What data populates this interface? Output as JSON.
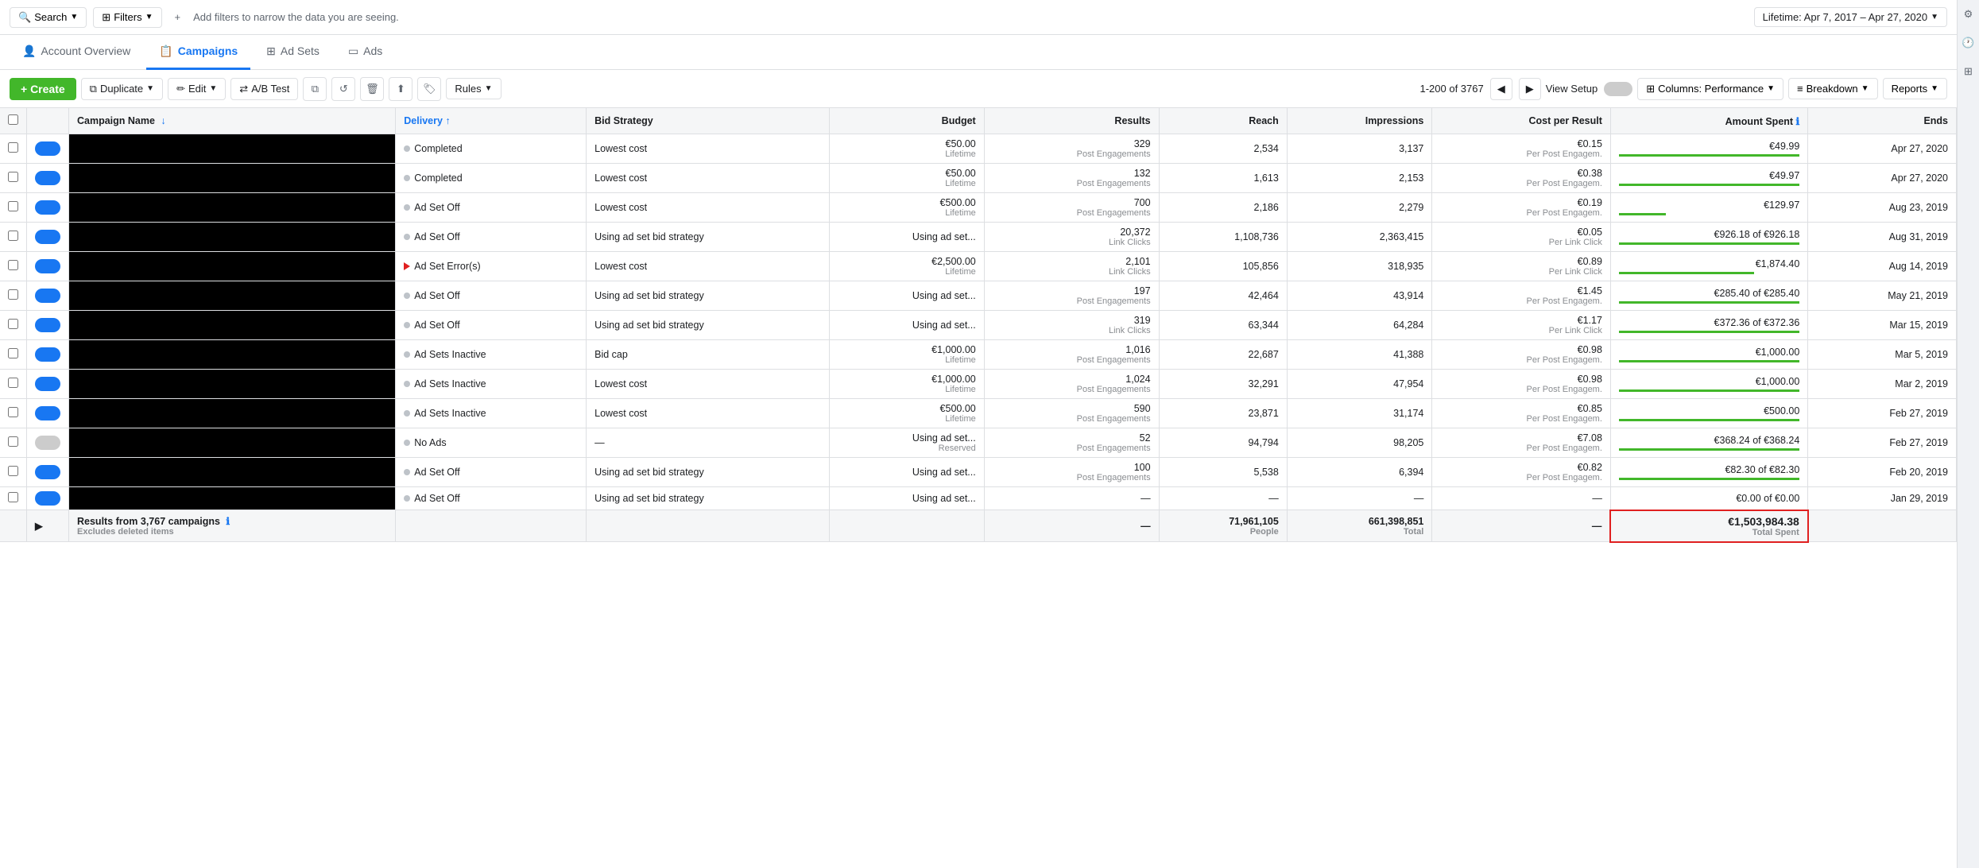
{
  "topbar": {
    "search_label": "Search",
    "filters_label": "Filters",
    "add_filter_label": "+",
    "filter_hint": "Add filters to narrow the data you are seeing.",
    "date_range": "Lifetime: Apr 7, 2017 – Apr 27, 2020"
  },
  "nav": {
    "account_overview": "Account Overview",
    "campaigns": "Campaigns",
    "ad_sets": "Ad Sets",
    "ads": "Ads"
  },
  "toolbar": {
    "create_label": "+ Create",
    "duplicate_label": "Duplicate",
    "edit_label": "Edit",
    "ab_test_label": "A/B Test",
    "rules_label": "Rules",
    "pagination": "1-200 of 3767",
    "view_setup": "View Setup",
    "columns_label": "Columns: Performance",
    "breakdown_label": "Breakdown",
    "reports_label": "Reports"
  },
  "table": {
    "headers": [
      {
        "key": "check",
        "label": ""
      },
      {
        "key": "toggle",
        "label": ""
      },
      {
        "key": "campaign_name",
        "label": "Campaign Name"
      },
      {
        "key": "delivery",
        "label": "Delivery"
      },
      {
        "key": "bid_strategy",
        "label": "Bid Strategy"
      },
      {
        "key": "budget",
        "label": "Budget"
      },
      {
        "key": "results",
        "label": "Results"
      },
      {
        "key": "reach",
        "label": "Reach"
      },
      {
        "key": "impressions",
        "label": "Impressions"
      },
      {
        "key": "cost_per_result",
        "label": "Cost per Result"
      },
      {
        "key": "amount_spent",
        "label": "Amount Spent"
      },
      {
        "key": "ends",
        "label": "Ends"
      }
    ],
    "rows": [
      {
        "toggle": "blue",
        "delivery_status": "Completed",
        "delivery_color": "gray",
        "bid_strategy": "Lowest cost",
        "budget": "€50.00",
        "budget_type": "Lifetime",
        "results": "329",
        "results_type": "Post Engagements",
        "reach": "2,534",
        "impressions": "3,137",
        "cost_per_result": "€0.15",
        "cost_type": "Per Post Engagem.",
        "amount_spent": "€49.99",
        "amount_bar": 100,
        "ends": "Apr 27, 2020"
      },
      {
        "toggle": "blue",
        "delivery_status": "Completed",
        "delivery_color": "gray",
        "bid_strategy": "Lowest cost",
        "budget": "€50.00",
        "budget_type": "Lifetime",
        "results": "132",
        "results_type": "Post Engagements",
        "reach": "1,613",
        "impressions": "2,153",
        "cost_per_result": "€0.38",
        "cost_type": "Per Post Engagem.",
        "amount_spent": "€49.97",
        "amount_bar": 100,
        "ends": "Apr 27, 2020"
      },
      {
        "toggle": "blue",
        "delivery_status": "Ad Set Off",
        "delivery_color": "gray",
        "bid_strategy": "Lowest cost",
        "budget": "€500.00",
        "budget_type": "Lifetime",
        "results": "700",
        "results_type": "Post Engagements",
        "reach": "2,186",
        "impressions": "2,279",
        "cost_per_result": "€0.19",
        "cost_type": "Per Post Engagem.",
        "amount_spent": "€129.97",
        "amount_bar": 26,
        "ends": "Aug 23, 2019"
      },
      {
        "toggle": "blue",
        "delivery_status": "Ad Set Off",
        "delivery_color": "gray",
        "bid_strategy": "Using ad set bid strategy",
        "budget": "Using ad set...",
        "budget_type": "",
        "results": "20,372",
        "results_type": "Link Clicks",
        "reach": "1,108,736",
        "impressions": "2,363,415",
        "cost_per_result": "€0.05",
        "cost_type": "Per Link Click",
        "amount_spent": "€926.18 of €926.18",
        "amount_bar": 100,
        "ends": "Aug 31, 2019"
      },
      {
        "toggle": "blue",
        "delivery_status": "Ad Set Error(s)",
        "delivery_color": "red",
        "bid_strategy": "Lowest cost",
        "budget": "€2,500.00",
        "budget_type": "Lifetime",
        "results": "2,101",
        "results_type": "Link Clicks",
        "reach": "105,856",
        "impressions": "318,935",
        "cost_per_result": "€0.89",
        "cost_type": "Per Link Click",
        "amount_spent": "€1,874.40",
        "amount_bar": 75,
        "ends": "Aug 14, 2019"
      },
      {
        "toggle": "blue",
        "delivery_status": "Ad Set Off",
        "delivery_color": "gray",
        "bid_strategy": "Using ad set bid strategy",
        "budget": "Using ad set...",
        "budget_type": "",
        "results": "197",
        "results_type": "Post Engagements",
        "reach": "42,464",
        "impressions": "43,914",
        "cost_per_result": "€1.45",
        "cost_type": "Per Post Engagem.",
        "amount_spent": "€285.40 of €285.40",
        "amount_bar": 100,
        "ends": "May 21, 2019"
      },
      {
        "toggle": "blue",
        "delivery_status": "Ad Set Off",
        "delivery_color": "gray",
        "bid_strategy": "Using ad set bid strategy",
        "budget": "Using ad set...",
        "budget_type": "",
        "results": "319",
        "results_type": "Link Clicks",
        "reach": "63,344",
        "impressions": "64,284",
        "cost_per_result": "€1.17",
        "cost_type": "Per Link Click",
        "amount_spent": "€372.36 of €372.36",
        "amount_bar": 100,
        "ends": "Mar 15, 2019"
      },
      {
        "toggle": "blue",
        "delivery_status": "Ad Sets Inactive",
        "delivery_color": "gray",
        "bid_strategy": "Bid cap",
        "budget": "€1,000.00",
        "budget_type": "Lifetime",
        "results": "1,016",
        "results_type": "Post Engagements",
        "reach": "22,687",
        "impressions": "41,388",
        "cost_per_result": "€0.98",
        "cost_type": "Per Post Engagem.",
        "amount_spent": "€1,000.00",
        "amount_bar": 100,
        "ends": "Mar 5, 2019"
      },
      {
        "toggle": "blue",
        "delivery_status": "Ad Sets Inactive",
        "delivery_color": "gray",
        "bid_strategy": "Lowest cost",
        "budget": "€1,000.00",
        "budget_type": "Lifetime",
        "results": "1,024",
        "results_type": "Post Engagements",
        "reach": "32,291",
        "impressions": "47,954",
        "cost_per_result": "€0.98",
        "cost_type": "Per Post Engagem.",
        "amount_spent": "€1,000.00",
        "amount_bar": 100,
        "ends": "Mar 2, 2019"
      },
      {
        "toggle": "blue",
        "delivery_status": "Ad Sets Inactive",
        "delivery_color": "gray",
        "bid_strategy": "Lowest cost",
        "budget": "€500.00",
        "budget_type": "Lifetime",
        "results": "590",
        "results_type": "Post Engagements",
        "reach": "23,871",
        "impressions": "31,174",
        "cost_per_result": "€0.85",
        "cost_type": "Per Post Engagem.",
        "amount_spent": "€500.00",
        "amount_bar": 100,
        "ends": "Feb 27, 2019"
      },
      {
        "toggle": "gray",
        "delivery_status": "No Ads",
        "delivery_color": "gray",
        "bid_strategy": "—",
        "budget": "Using ad set...",
        "budget_type": "Reserved",
        "results": "52",
        "results_type": "Post Engagements",
        "reach": "94,794",
        "impressions": "98,205",
        "cost_per_result": "€7.08",
        "cost_type": "Per Post Engagem.",
        "amount_spent": "€368.24 of €368.24",
        "amount_bar": 100,
        "ends": "Feb 27, 2019"
      },
      {
        "toggle": "blue",
        "delivery_status": "Ad Set Off",
        "delivery_color": "gray",
        "bid_strategy": "Using ad set bid strategy",
        "budget": "Using ad set...",
        "budget_type": "",
        "results": "100",
        "results_type": "Post Engagements",
        "reach": "5,538",
        "impressions": "6,394",
        "cost_per_result": "€0.82",
        "cost_type": "Per Post Engagem.",
        "amount_spent": "€82.30 of €82.30",
        "amount_bar": 100,
        "ends": "Feb 20, 2019"
      },
      {
        "toggle": "blue",
        "delivery_status": "Ad Set Off",
        "delivery_color": "gray",
        "bid_strategy": "Using ad set bid strategy",
        "budget": "Using ad set...",
        "budget_type": "",
        "results": "—",
        "results_type": "",
        "reach": "—",
        "impressions": "—",
        "cost_per_result": "—",
        "cost_type": "",
        "amount_spent": "€0.00 of €0.00",
        "amount_bar": 0,
        "ends": "Jan 29, 2019"
      }
    ],
    "footer": {
      "label": "Results from 3,767 campaigns",
      "sublabel": "Excludes deleted items",
      "reach": "71,961,105",
      "reach_type": "People",
      "impressions": "661,398,851",
      "impressions_type": "Total",
      "total_spent": "€1,503,984.38",
      "total_spent_label": "Total Spent"
    }
  }
}
